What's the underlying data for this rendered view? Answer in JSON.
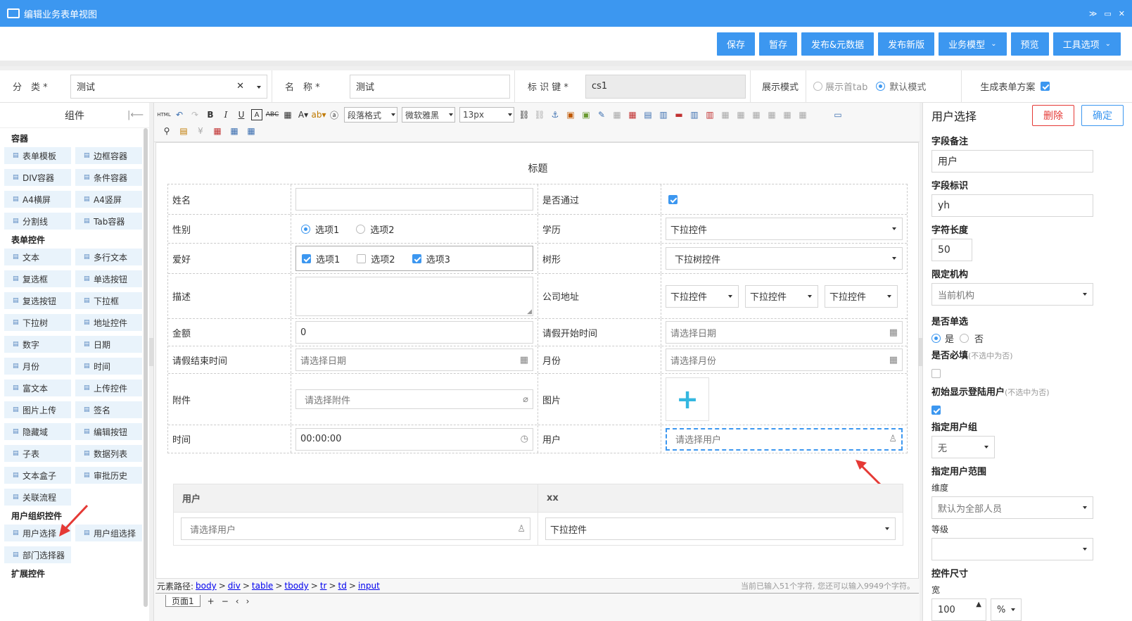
{
  "window": {
    "title": "编辑业务表单视图"
  },
  "actions": [
    "保存",
    "暂存",
    "发布&元数据",
    "发布新版",
    "业务模型",
    "预览",
    "工具选项"
  ],
  "formbar": {
    "category_label": "分　类 *",
    "category_value": "测试",
    "name_label": "名　称 *",
    "name_value": "测试",
    "key_label": "标 识 键 *",
    "key_value": "cs1",
    "mode_label": "展示模式",
    "mode_opt1": "展示首tab",
    "mode_opt2": "默认模式",
    "gen_label": "生成表单方案"
  },
  "left": {
    "title": "组件",
    "sections": [
      {
        "name": "容器",
        "items": [
          "表单模板",
          "边框容器",
          "DIV容器",
          "条件容器",
          "A4横屏",
          "A4竖屏",
          "分割线",
          "Tab容器"
        ]
      },
      {
        "name": "表单控件",
        "items": [
          "文本",
          "多行文本",
          "复选框",
          "单选按钮",
          "复选按钮",
          "下拉框",
          "下拉树",
          "地址控件",
          "数字",
          "日期",
          "月份",
          "时间",
          "富文本",
          "上传控件",
          "图片上传",
          "签名",
          "隐藏域",
          "编辑按钮",
          "子表",
          "数据列表",
          "文本盒子",
          "审批历史",
          "关联流程"
        ]
      },
      {
        "name": "用户组织控件",
        "items": [
          "用户选择",
          "用户组选择",
          "部门选择器"
        ]
      },
      {
        "name": "扩展控件",
        "items": []
      }
    ]
  },
  "toolbar": {
    "para": "段落格式",
    "font": "微软雅黑",
    "size": "13px"
  },
  "canvas": {
    "title": "标题",
    "fields": {
      "name": "姓名",
      "pass": "是否通过",
      "gender": "性别",
      "opt1": "选项1",
      "opt2": "选项2",
      "opt3": "选项3",
      "edu": "学历",
      "dropdown": "下拉控件",
      "hobby": "爱好",
      "tree": "树形",
      "treedrop": "下拉树控件",
      "desc": "描述",
      "addr": "公司地址",
      "amount": "金额",
      "amount_val": "0",
      "leave_start": "请假开始时间",
      "pick_date": "请选择日期",
      "leave_end": "请假结束时间",
      "month": "月份",
      "pick_month": "请选择月份",
      "attach": "附件",
      "pick_attach": "请选择附件",
      "image": "图片",
      "time": "时间",
      "time_val": "00:00:00",
      "user": "用户",
      "pick_user": "请选择用户"
    },
    "sub": {
      "col1": "用户",
      "col2": "xx"
    }
  },
  "pathbar": {
    "label": "元素路径:",
    "path": [
      "body",
      "div",
      "table",
      "tbody",
      "tr",
      "td",
      "input"
    ],
    "count": "当前已输入51个字符, 您还可以输入9949个字符。"
  },
  "pages": {
    "tab": "页面1"
  },
  "right": {
    "title": "用户选择",
    "delete": "删除",
    "confirm": "确定",
    "remark_label": "字段备注",
    "remark": "用户",
    "key_label": "字段标识",
    "key": "yh",
    "len_label": "字符长度",
    "len": "50",
    "org_label": "限定机构",
    "org": "当前机构",
    "single_label": "是否单选",
    "yes": "是",
    "no": "否",
    "required_label": "是否必填",
    "required_hint": "(不选中为否)",
    "init_label": "初始显示登陆用户",
    "init_hint": "(不选中为否)",
    "group_label": "指定用户组",
    "group": "无",
    "range_label": "指定用户范围",
    "dim_label": "维度",
    "dim": "默认为全部人员",
    "level_label": "等级",
    "size_label": "控件尺寸",
    "width_label": "宽",
    "width": "100",
    "unit": "%"
  }
}
